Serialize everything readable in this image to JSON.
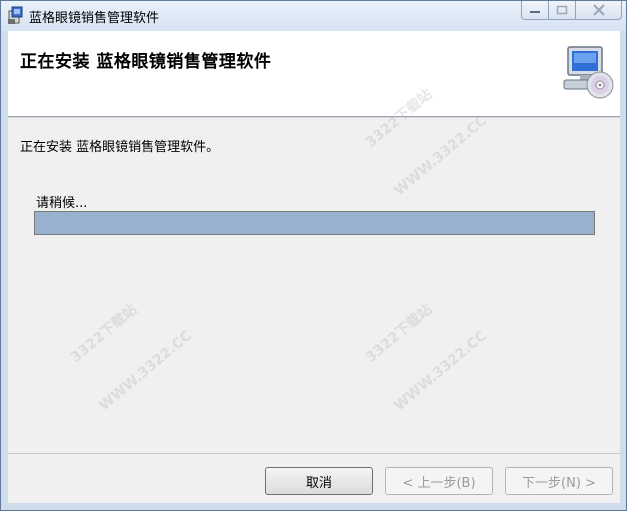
{
  "window": {
    "title": "蓝格眼镜销售管理软件",
    "caption_icons": [
      "minimize-icon",
      "maximize-icon",
      "close-icon"
    ]
  },
  "header": {
    "title": "正在安装 蓝格眼镜销售管理软件",
    "icon": "computer-cd-icon"
  },
  "body": {
    "status_text": "正在安装 蓝格眼镜销售管理软件。",
    "wait_label": "请稍候...",
    "progress_fraction": 1.0
  },
  "buttons": {
    "cancel": "取消",
    "back": "< 上一步(B)",
    "next": "下一步(N) >"
  },
  "watermark": {
    "lines": [
      "3322下载站",
      "WWW.3322.CC"
    ]
  },
  "colors": {
    "progress_fill": "#97b1cf",
    "header_bg": "#ffffff",
    "body_bg": "#f0f0f0"
  }
}
